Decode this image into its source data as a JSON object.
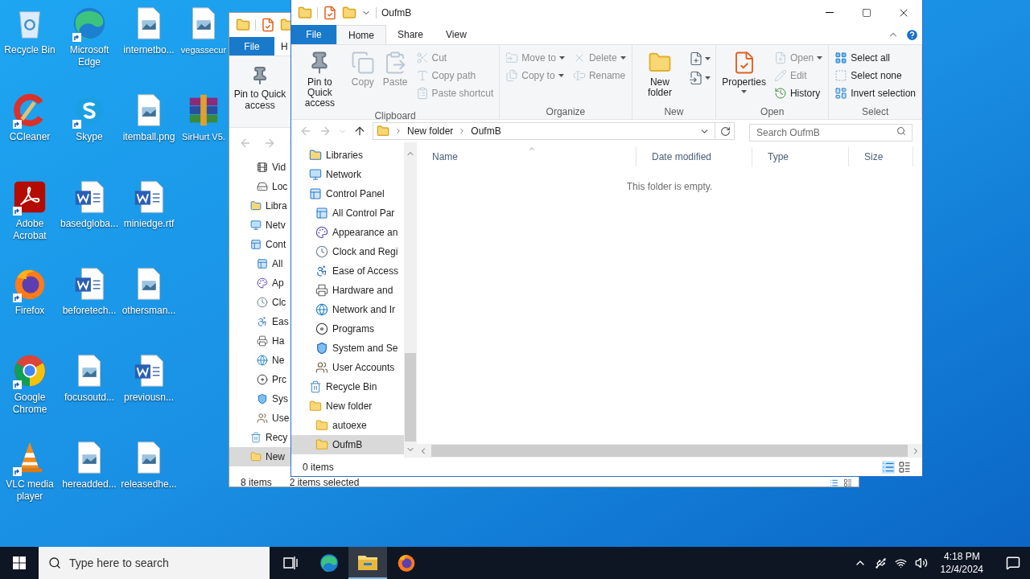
{
  "desktop": {
    "columns": [
      [
        {
          "label": "Recycle Bin",
          "kind": "recycle",
          "shortcut": false
        },
        {
          "label": "CCleaner",
          "kind": "ccleaner",
          "shortcut": true
        },
        {
          "label": "Adobe Acrobat",
          "kind": "acrobat",
          "shortcut": true
        },
        {
          "label": "Firefox",
          "kind": "firefox",
          "shortcut": true
        },
        {
          "label": "Google Chrome",
          "kind": "chrome",
          "shortcut": true
        },
        {
          "label": "VLC media player",
          "kind": "vlc",
          "shortcut": true
        }
      ],
      [
        {
          "label": "Microsoft Edge",
          "kind": "edge",
          "shortcut": true
        },
        {
          "label": "Skype",
          "kind": "skype",
          "shortcut": true
        },
        {
          "label": "basedgloba...",
          "kind": "word",
          "shortcut": false
        },
        {
          "label": "beforetech...",
          "kind": "word",
          "shortcut": false
        },
        {
          "label": "focusoutd...",
          "kind": "image",
          "shortcut": false
        },
        {
          "label": "hereadded...",
          "kind": "image",
          "shortcut": false
        }
      ],
      [
        {
          "label": "internetbo...",
          "kind": "image",
          "shortcut": false
        },
        {
          "label": "itemball.png",
          "kind": "image",
          "shortcut": false
        },
        {
          "label": "miniedge.rtf",
          "kind": "word",
          "shortcut": false
        },
        {
          "label": "othersman...",
          "kind": "image",
          "shortcut": false
        },
        {
          "label": "previousn...",
          "kind": "word",
          "shortcut": false
        },
        {
          "label": "releasedhe...",
          "kind": "image",
          "shortcut": false
        }
      ],
      [
        {
          "label": "vegassecur",
          "kind": "image",
          "shortcut": false
        },
        {
          "label": "SirHurt V5.",
          "kind": "winrar",
          "shortcut": false
        }
      ]
    ]
  },
  "back_window": {
    "tabs": [
      {
        "label": "File",
        "kind": "file"
      },
      {
        "label": "H",
        "kind": "tab"
      }
    ],
    "ribbon_button": "Pin to Quick access",
    "nav": [
      {
        "children": [
          {
            "label": "Vid",
            "kind": "video",
            "selected": false
          },
          {
            "label": "Loc",
            "kind": "drive",
            "selected": false
          }
        ]
      },
      {
        "label": "Libra",
        "kind": "libraries",
        "selected": false
      },
      {
        "label": "Netv",
        "kind": "network",
        "selected": false
      },
      {
        "label": "Cont",
        "kind": "control-panel",
        "selected": false,
        "children": [
          {
            "label": "All",
            "kind": "control-panel",
            "selected": false
          },
          {
            "label": "Ap",
            "kind": "appearance",
            "selected": false
          },
          {
            "label": "Clc",
            "kind": "clock",
            "selected": false
          },
          {
            "label": "Eas",
            "kind": "ease",
            "selected": false
          },
          {
            "label": "Ha",
            "kind": "hardware",
            "selected": false
          },
          {
            "label": "Ne",
            "kind": "internet",
            "selected": false
          },
          {
            "label": "Prc",
            "kind": "programs",
            "selected": false
          },
          {
            "label": "Sys",
            "kind": "system",
            "selected": false
          },
          {
            "label": "Use",
            "kind": "users",
            "selected": false
          }
        ]
      },
      {
        "label": "Recy",
        "kind": "recycle",
        "selected": false
      },
      {
        "label": "New",
        "kind": "folder",
        "selected": true
      }
    ],
    "status": [
      "8 items",
      "2 items selected"
    ]
  },
  "explorer": {
    "title": "OufmB",
    "tabs": [
      {
        "label": "File",
        "kind": "file",
        "selected": false
      },
      {
        "label": "Home",
        "kind": "tab",
        "selected": true
      },
      {
        "label": "Share",
        "kind": "tab",
        "selected": false
      },
      {
        "label": "View",
        "kind": "tab",
        "selected": false
      }
    ],
    "ribbon": [
      {
        "name": "Clipboard",
        "items": [
          {
            "kind": "large",
            "label": "Pin to Quick access",
            "disabled": false,
            "dropdown": false
          },
          {
            "kind": "large",
            "label": "Copy",
            "disabled": true,
            "dropdown": false
          },
          {
            "kind": "large",
            "label": "Paste",
            "disabled": true,
            "dropdown": false
          },
          {
            "kind": "stack",
            "items": [
              {
                "label": "Cut",
                "disabled": true,
                "dropdown": false
              },
              {
                "label": "Copy path",
                "disabled": true,
                "dropdown": false
              },
              {
                "label": "Paste shortcut",
                "disabled": true,
                "dropdown": false
              }
            ]
          }
        ]
      },
      {
        "name": "Organize",
        "items": [
          {
            "kind": "stack",
            "items": [
              {
                "label": "Move to",
                "disabled": true,
                "dropdown": true
              },
              {
                "label": "Copy to",
                "disabled": true,
                "dropdown": true
              }
            ]
          },
          {
            "kind": "stack",
            "items": [
              {
                "label": "Delete",
                "disabled": true,
                "dropdown": true
              },
              {
                "label": "Rename",
                "disabled": true,
                "dropdown": false
              }
            ]
          }
        ]
      },
      {
        "name": "New",
        "items": [
          {
            "kind": "large",
            "label": "New folder",
            "disabled": false,
            "dropdown": false
          },
          {
            "kind": "icons",
            "items": [
              {
                "dropdown": true
              },
              {
                "dropdown": true
              }
            ]
          }
        ]
      },
      {
        "name": "Open",
        "items": [
          {
            "kind": "large",
            "label": "Properties",
            "disabled": false,
            "dropdown": true
          },
          {
            "kind": "stack",
            "items": [
              {
                "label": "Open",
                "disabled": true,
                "dropdown": true
              },
              {
                "label": "Edit",
                "disabled": true,
                "dropdown": false
              },
              {
                "label": "History",
                "disabled": false,
                "dropdown": false
              }
            ]
          }
        ]
      },
      {
        "name": "Select",
        "items": [
          {
            "kind": "stack",
            "items": [
              {
                "label": "Select all",
                "disabled": false,
                "dropdown": false
              },
              {
                "label": "Select none",
                "disabled": false,
                "dropdown": false
              },
              {
                "label": "Invert selection",
                "disabled": false,
                "dropdown": false
              }
            ]
          }
        ]
      }
    ],
    "path": [
      "New folder",
      "OufmB"
    ],
    "search": {
      "placeholder": "Search OufmB"
    },
    "nav": [
      {
        "label": "Libraries",
        "kind": "libraries",
        "selected": false
      },
      {
        "label": "Network",
        "kind": "network",
        "selected": false
      },
      {
        "label": "Control Panel",
        "kind": "control-panel",
        "selected": false,
        "children": [
          {
            "label": "All Control Par",
            "kind": "control-panel",
            "selected": false
          },
          {
            "label": "Appearance an",
            "kind": "appearance",
            "selected": false
          },
          {
            "label": "Clock and Regi",
            "kind": "clock",
            "selected": false
          },
          {
            "label": "Ease of Access",
            "kind": "ease",
            "selected": false
          },
          {
            "label": "Hardware and",
            "kind": "hardware",
            "selected": false
          },
          {
            "label": "Network and Ir",
            "kind": "internet",
            "selected": false
          },
          {
            "label": "Programs",
            "kind": "programs",
            "selected": false
          },
          {
            "label": "System and Se",
            "kind": "system",
            "selected": false
          },
          {
            "label": "User Accounts",
            "kind": "users",
            "selected": false
          }
        ]
      },
      {
        "label": "Recycle Bin",
        "kind": "recycle",
        "selected": false
      },
      {
        "label": "New folder",
        "kind": "folder",
        "selected": false,
        "children": [
          {
            "label": "autoexe",
            "kind": "folder",
            "selected": false
          },
          {
            "label": "OufmB",
            "kind": "folder",
            "selected": true
          }
        ]
      }
    ],
    "columns": [
      "Name",
      "Date modified",
      "Type",
      "Size"
    ],
    "empty_message": "This folder is empty.",
    "status": "0 items"
  },
  "taskbar": {
    "search": {
      "placeholder": "Type here to search"
    },
    "apps": [
      {
        "kind": "task-view",
        "selected": false
      },
      {
        "kind": "edge",
        "selected": false
      },
      {
        "kind": "explorer",
        "selected": true
      },
      {
        "kind": "firefox",
        "selected": false
      }
    ],
    "time": "4:18 PM",
    "date": "12/4/2024"
  }
}
